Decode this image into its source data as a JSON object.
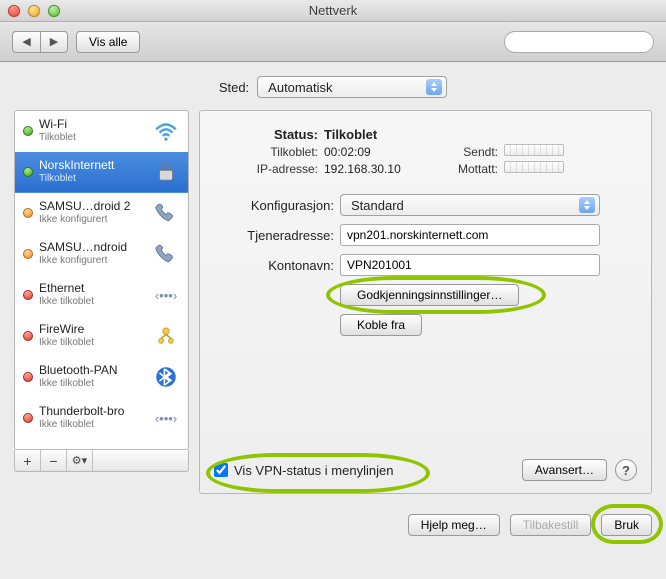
{
  "window": {
    "title": "Nettverk"
  },
  "toolbar": {
    "show_all": "Vis alle",
    "search_placeholder": ""
  },
  "location": {
    "label": "Sted:",
    "value": "Automatisk"
  },
  "sidebar": {
    "items": [
      {
        "name": "Wi-Fi",
        "status": "Tilkoblet",
        "dot": "green",
        "icon": "wifi"
      },
      {
        "name": "NorskInternett",
        "status": "Tilkoblet",
        "dot": "green",
        "icon": "lock",
        "selected": true
      },
      {
        "name": "SAMSU…droid 2",
        "status": "Ikke konfigurert",
        "dot": "orange",
        "icon": "phone"
      },
      {
        "name": "SAMSU…ndroid",
        "status": "Ikke konfigurert",
        "dot": "orange",
        "icon": "phone"
      },
      {
        "name": "Ethernet",
        "status": "Ikke tilkoblet",
        "dot": "red",
        "icon": "ethernet"
      },
      {
        "name": "FireWire",
        "status": "Ikke tilkoblet",
        "dot": "red",
        "icon": "firewire"
      },
      {
        "name": "Bluetooth-PAN",
        "status": "Ikke tilkoblet",
        "dot": "red",
        "icon": "bluetooth"
      },
      {
        "name": "Thunderbolt-bro",
        "status": "Ikke tilkoblet",
        "dot": "red",
        "icon": "ethernet"
      }
    ],
    "footer": {
      "add": "+",
      "remove": "−",
      "gear": "⚙︎▾"
    }
  },
  "details": {
    "status_label": "Status:",
    "status_value": "Tilkoblet",
    "connected_label": "Tilkoblet:",
    "connected_value": "00:02:09",
    "ip_label": "IP-adresse:",
    "ip_value": "192.168.30.10",
    "sent_label": "Sendt:",
    "recv_label": "Mottatt:",
    "config_label": "Konfigurasjon:",
    "config_value": "Standard",
    "server_label": "Tjeneradresse:",
    "server_value": "vpn201.norskinternett.com",
    "account_label": "Kontonavn:",
    "account_value": "VPN201001",
    "auth_button": "Godkjenningsinnstillinger…",
    "disconnect_button": "Koble fra",
    "show_status_label": "Vis VPN-status i menylinjen",
    "advanced_button": "Avansert…"
  },
  "footer": {
    "help": "Hjelp meg…",
    "revert": "Tilbakestill",
    "apply": "Bruk"
  }
}
